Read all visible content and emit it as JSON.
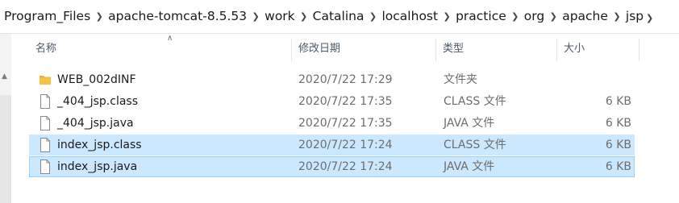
{
  "breadcrumb": [
    "Program_Files",
    "apache-tomcat-8.5.53",
    "work",
    "Catalina",
    "localhost",
    "practice",
    "org",
    "apache",
    "jsp"
  ],
  "columns": {
    "name": "名称",
    "date": "修改日期",
    "type": "类型",
    "size": "大小"
  },
  "files": [
    {
      "name": "WEB_002dINF",
      "date": "2020/7/22 17:29",
      "type": "文件夹",
      "size": "",
      "icon": "folder-icon"
    },
    {
      "name": "_404_jsp.class",
      "date": "2020/7/22 17:35",
      "type": "CLASS 文件",
      "size": "6 KB",
      "icon": "file-icon"
    },
    {
      "name": "_404_jsp.java",
      "date": "2020/7/22 17:35",
      "type": "JAVA 文件",
      "size": "6 KB",
      "icon": "file-icon"
    },
    {
      "name": "index_jsp.class",
      "date": "2020/7/22 17:24",
      "type": "CLASS 文件",
      "size": "6 KB",
      "icon": "file-icon",
      "selected": true
    },
    {
      "name": "index_jsp.java",
      "date": "2020/7/22 17:24",
      "type": "JAVA 文件",
      "size": "6 KB",
      "icon": "file-icon",
      "selected": true
    }
  ],
  "colors": {
    "selection": "#cce8ff",
    "selection_border": "#99d1ff",
    "folder": "#f5c242",
    "header_text": "#4d5a6a"
  }
}
